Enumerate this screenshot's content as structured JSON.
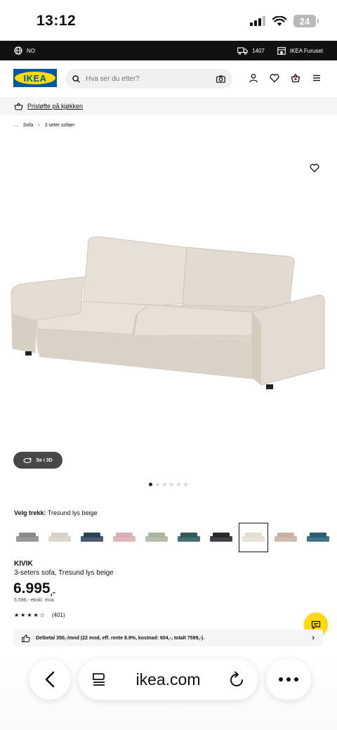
{
  "status": {
    "time": "13:12",
    "battery": "24"
  },
  "topstrip": {
    "country": "NO",
    "postal": "1407",
    "store": "IKEA Furuset"
  },
  "header": {
    "logo": "IKEA",
    "search_placeholder": "Hva ser du etter?"
  },
  "promo": {
    "text": "Prisløfte på kjøkken"
  },
  "breadcrumb": {
    "ellipsis": "...",
    "level1": "Sofa",
    "separator": "›",
    "level2": "3 seter sofaer"
  },
  "view3d": {
    "label": "Se i 3D"
  },
  "carousel": {
    "total": 6,
    "active": 0
  },
  "cover": {
    "prefix": "Velg trekk:",
    "selected": "Tresund lys beige",
    "swatches": [
      "#8a8a88",
      "#d8d0c6",
      "#2f4356",
      "#d9aeb4",
      "#a9b59c",
      "#2f5a5c",
      "#272a2e",
      "#e4ddd2",
      "#c7b3a3",
      "#2a5e74"
    ],
    "selected_index": 7
  },
  "product": {
    "name": "KIVIK",
    "description": "3-seters sofa, Tresund lys beige",
    "price": "6.995",
    "price_suffix": ",-",
    "price_ex": "5.596,- ekskl. mva",
    "rating": 4,
    "reviews": "(401)"
  },
  "finance": {
    "text": "Delbetal 350,-/mnd (22 mnd, eff. rente 8.9%, kostnad: 604,-, totalt 7599,-)."
  },
  "browser": {
    "url": "ikea.com"
  },
  "colors": {
    "ikea_blue": "#0058a3",
    "ikea_yellow": "#ffdb00"
  }
}
